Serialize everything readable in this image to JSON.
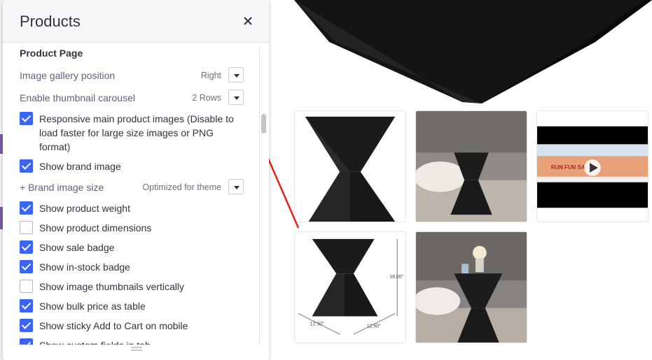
{
  "panel": {
    "title": "Products",
    "section_title": "Product Page",
    "selects": [
      {
        "label": "Image gallery position",
        "value": "Right"
      },
      {
        "label": "Enable thumbnail carousel",
        "value": "2 Rows"
      },
      {
        "label": "+ Brand image size",
        "value": "Optimized for theme"
      }
    ],
    "checks": [
      {
        "label": "Responsive main product images (Disable to load faster for large size images or PNG format)",
        "checked": true
      },
      {
        "label": "Show brand image",
        "checked": true
      },
      {
        "label": "Show product weight",
        "checked": true
      },
      {
        "label": "Show product dimensions",
        "checked": false
      },
      {
        "label": "Show sale badge",
        "checked": true
      },
      {
        "label": "Show in-stock badge",
        "checked": true
      },
      {
        "label": "Show image thumbnails vertically",
        "checked": false
      },
      {
        "label": "Show bulk price as table",
        "checked": true
      },
      {
        "label": "Show sticky Add to Cart on mobile",
        "checked": true
      },
      {
        "label": "Show custom fields in tab",
        "checked": true
      }
    ]
  },
  "gallery": {
    "video_banner_text": "RUN FUN SA",
    "dimension_height": "18.00\"",
    "dimension_width_left": "12.50\"",
    "dimension_width_right": "12.50\""
  },
  "colors": {
    "accent": "#3c64f4",
    "annotation_arrow": "#e8201a"
  }
}
